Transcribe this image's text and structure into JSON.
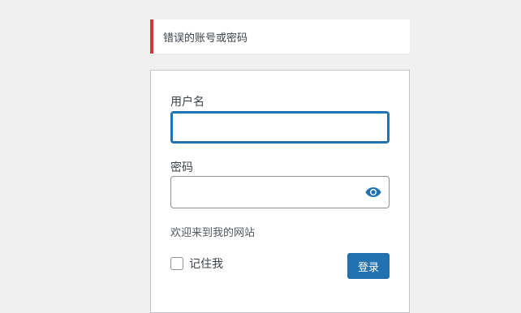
{
  "notice": {
    "error_text": "错误的账号或密码",
    "accent_color": "#d63638"
  },
  "form": {
    "username_label": "用户名",
    "username_value": "",
    "password_label": "密码",
    "password_value": "",
    "site_text": "欢迎来到我的网站",
    "remember_label": "记住我",
    "submit_label": "登录",
    "primary_color": "#2271b1",
    "eye_icon": "eye-icon"
  }
}
